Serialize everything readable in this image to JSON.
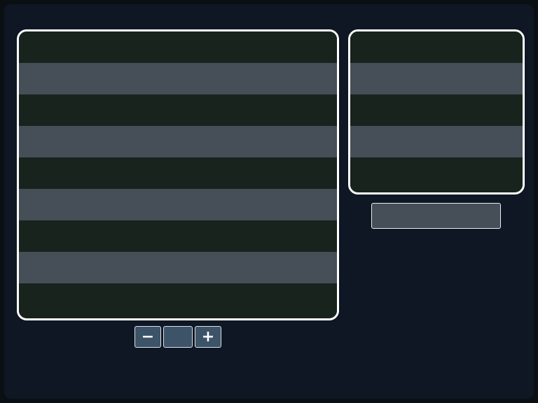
{
  "colors": {
    "background": "#0e1723",
    "board_border": "#ffffff",
    "row_dark": "#19231e",
    "row_light": "#464f57",
    "control_fill": "#3d5368"
  },
  "main_board": {
    "row_pattern": [
      "dark",
      "light",
      "dark",
      "light",
      "dark",
      "light",
      "dark",
      "light",
      "dark"
    ]
  },
  "preview_board": {
    "row_pattern": [
      "dark",
      "light",
      "dark",
      "light",
      "dark"
    ]
  },
  "status_bar": {
    "text": ""
  },
  "stepper": {
    "decrement_icon": "minus-icon",
    "increment_icon": "plus-icon",
    "decrement_glyph": "−",
    "increment_glyph": "+",
    "value": ""
  }
}
